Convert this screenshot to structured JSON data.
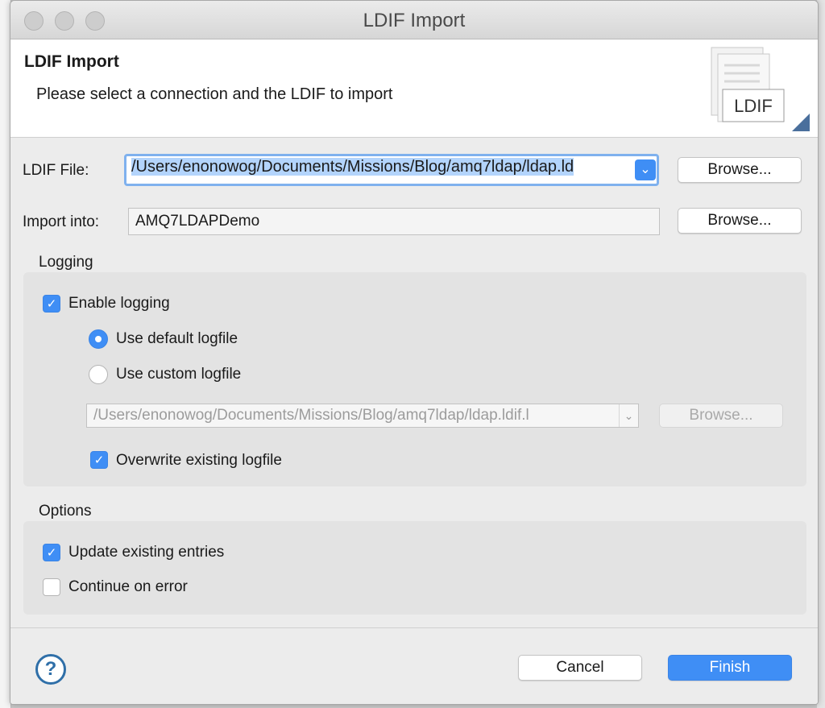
{
  "window": {
    "title": "LDIF Import"
  },
  "header": {
    "title": "LDIF Import",
    "description": "Please select a connection and the LDIF to import",
    "banner_label": "LDIF"
  },
  "form": {
    "ldif_file_label": "LDIF File:",
    "ldif_file_value": "/Users/enonowog/Documents/Missions/Blog/amq7ldap/ldap.ld",
    "ldif_browse_label": "Browse...",
    "import_into_label": "Import into:",
    "import_into_value": "AMQ7LDAPDemo",
    "import_browse_label": "Browse..."
  },
  "logging": {
    "group_title": "Logging",
    "enable_label": "Enable logging",
    "enable_checked": true,
    "default_logfile_label": "Use default logfile",
    "custom_logfile_label": "Use custom logfile",
    "selected_option": "default",
    "logfile_path": "/Users/enonowog/Documents/Missions/Blog/amq7ldap/ldap.ldif.l",
    "logfile_browse_label": "Browse...",
    "overwrite_label": "Overwrite existing logfile",
    "overwrite_checked": true
  },
  "options": {
    "group_title": "Options",
    "update_label": "Update existing entries",
    "update_checked": true,
    "continue_label": "Continue on error",
    "continue_checked": false
  },
  "footer": {
    "help_label": "?",
    "cancel_label": "Cancel",
    "finish_label": "Finish"
  },
  "colors": {
    "accent": "#3f8ef5",
    "focus_ring": "#7fb1ee",
    "selection": "#b3d4fc"
  },
  "icons": {
    "checkmark": "checkmark-icon",
    "dropdown": "chevron-down-icon",
    "help": "help-icon",
    "banner": "ldif-document-icon"
  }
}
